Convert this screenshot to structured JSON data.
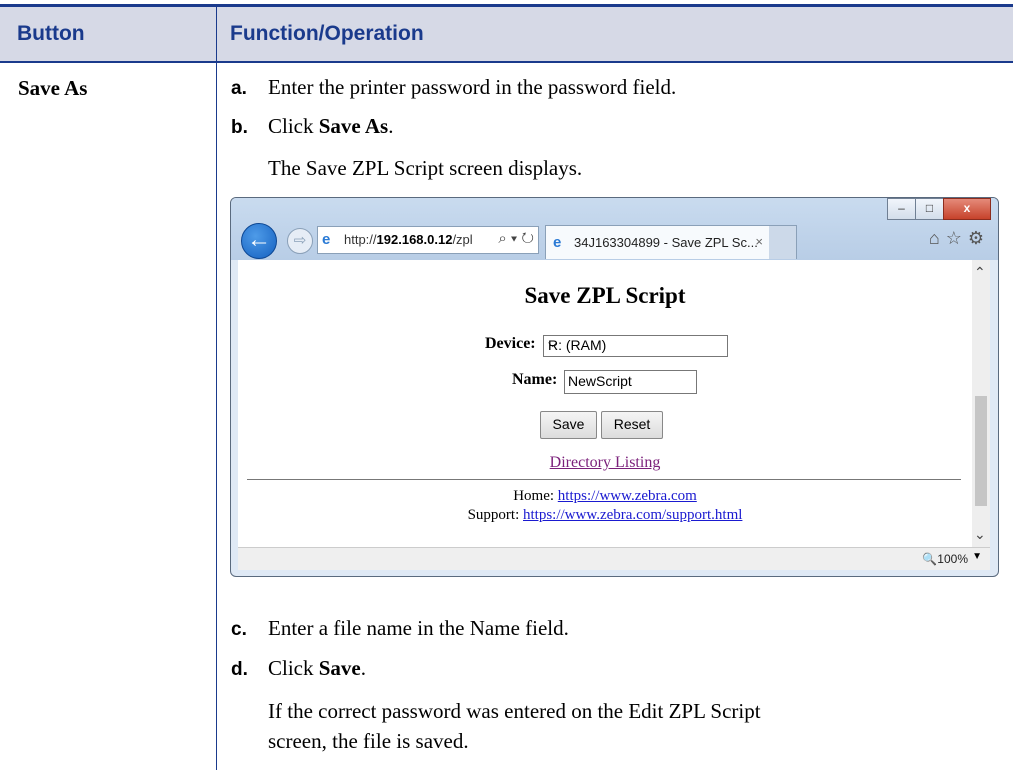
{
  "table": {
    "header": {
      "button_col": "Button",
      "function_col": "Function/Operation"
    },
    "row": {
      "button": "Save As",
      "step_a": {
        "letter": "a.",
        "text": "Enter the printer password in the password field."
      },
      "step_b": {
        "letter": "b.",
        "text": "Click ",
        "bold": "Save As",
        "end": "."
      },
      "result_b": "The Save ZPL Script screen displays.",
      "step_c": {
        "letter": "c.",
        "text": "Enter a file name in the Name field."
      },
      "step_d": {
        "letter": "d.",
        "text": "Click ",
        "bold": "Save",
        "end": "."
      },
      "result_d_line1": "If the correct password was entered on the Edit ZPL Script",
      "result_d_line2": "screen, the file is saved."
    }
  },
  "browser": {
    "window_buttons": {
      "minimize": "–",
      "maximize": "□",
      "close": "x"
    },
    "address": {
      "prefix": "http://",
      "host": "192.168.0.12",
      "path": "/zpl",
      "tools": "⌕ ▾ ↻"
    },
    "tab": {
      "title": "34J163304899 - Save ZPL Sc...",
      "close": "×"
    },
    "nav_icons": {
      "home": "⌂",
      "favorites": "☆",
      "settings": "⚙"
    },
    "page": {
      "title": "Save ZPL Script",
      "device_label": "Device:",
      "device_value": "R: (RAM)",
      "name_label": "Name:",
      "name_value": "NewScript",
      "save_label": "Save",
      "reset_label": "Reset",
      "directory_link": "Directory Listing",
      "home_label": "Home: ",
      "home_url": "https://www.zebra.com",
      "support_label": "Support: ",
      "support_url": "https://www.zebra.com/support.html"
    },
    "status": {
      "zoom": "100%"
    }
  },
  "colors": {
    "accent": "#1a3a8c",
    "header_bg": "#d6d9e6",
    "link": "#1a1ad0",
    "visited_link": "#7a1f7a"
  }
}
